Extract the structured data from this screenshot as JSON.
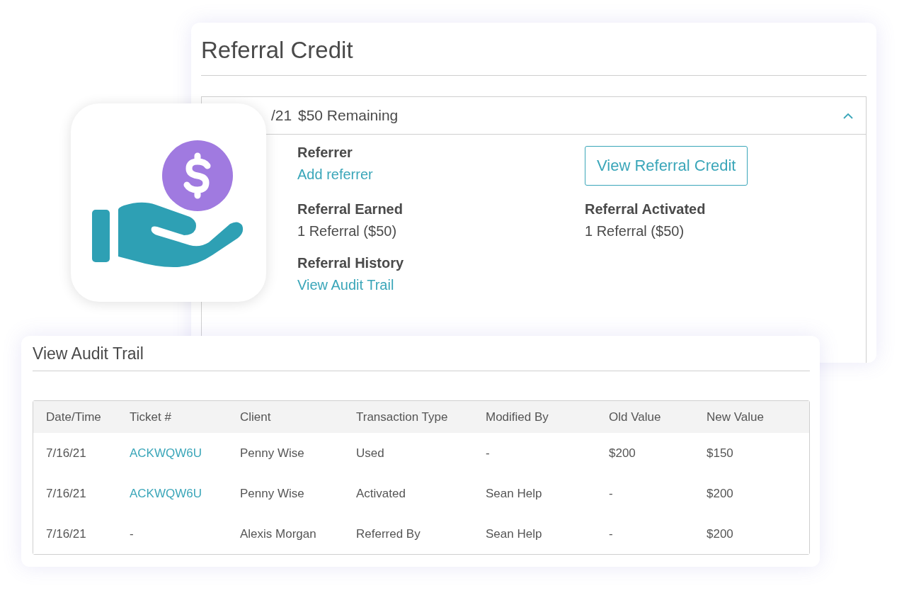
{
  "referral_card": {
    "title": "Referral Credit",
    "accordion": {
      "date": "/21",
      "summary": "$50 Remaining",
      "expanded": true,
      "items": [
        {
          "kind": "field",
          "label": "Referrer",
          "value": "Add referrer",
          "link": true
        },
        {
          "kind": "button",
          "label": "View Referral Credit"
        },
        {
          "kind": "field",
          "label": "Referral Earned",
          "value": "1 Referral ($50)",
          "link": false
        },
        {
          "kind": "field",
          "label": "Referral Activated",
          "value": "1 Referral ($50)",
          "link": false
        },
        {
          "kind": "field",
          "label": "Referral History",
          "value": "View Audit Trail",
          "link": true
        }
      ]
    }
  },
  "audit_card": {
    "title": "View Audit Trail",
    "columns": [
      "Date/Time",
      "Ticket #",
      "Client",
      "Transaction Type",
      "Modified By",
      "Old Value",
      "New Value"
    ],
    "rows": [
      [
        {
          "text": "7/16/21",
          "kind": "text"
        },
        {
          "text": "ACKWQW6U",
          "kind": "link"
        },
        {
          "text": "Penny Wise",
          "kind": "text"
        },
        {
          "text": "Used",
          "kind": "text"
        },
        {
          "text": "-",
          "kind": "text"
        },
        {
          "text": "$200",
          "kind": "text"
        },
        {
          "text": "$150",
          "kind": "text"
        }
      ],
      [
        {
          "text": "7/16/21",
          "kind": "text"
        },
        {
          "text": "ACKWQW6U",
          "kind": "link"
        },
        {
          "text": "Penny Wise",
          "kind": "text"
        },
        {
          "text": "Activated",
          "kind": "text"
        },
        {
          "text": "Sean Help",
          "kind": "text"
        },
        {
          "text": "-",
          "kind": "text"
        },
        {
          "text": "$200",
          "kind": "text"
        }
      ],
      [
        {
          "text": "7/16/21",
          "kind": "text"
        },
        {
          "text": "-",
          "kind": "text"
        },
        {
          "text": "Alexis Morgan",
          "kind": "text"
        },
        {
          "text": "Referred By",
          "kind": "text"
        },
        {
          "text": "Sean Help",
          "kind": "text"
        },
        {
          "text": "-",
          "kind": "text"
        },
        {
          "text": "$200",
          "kind": "text"
        }
      ]
    ]
  }
}
